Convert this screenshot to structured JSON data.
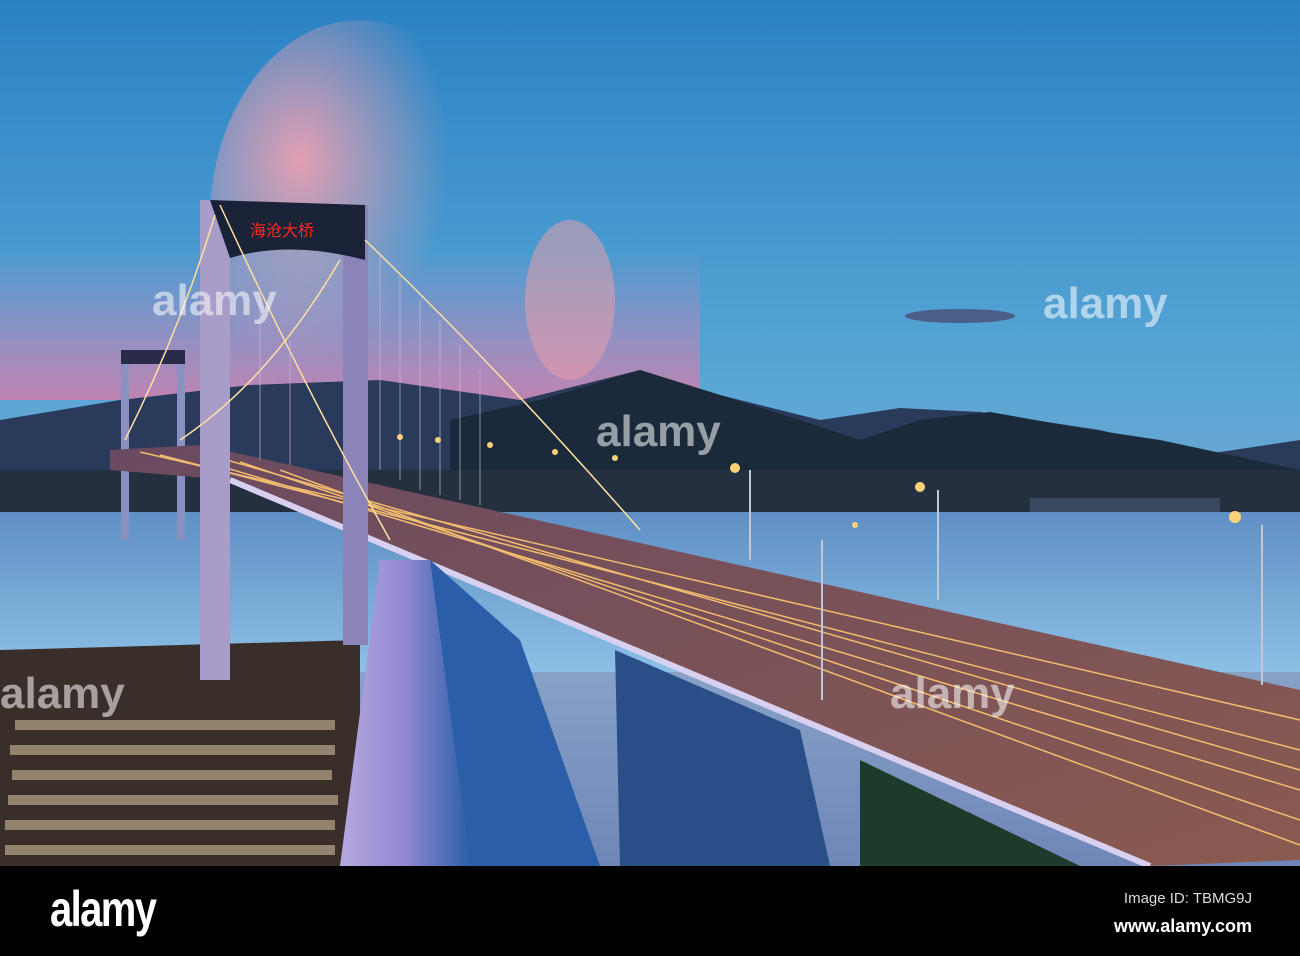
{
  "photo": {
    "subject": "suspension-bridge-at-dusk",
    "sign_text": "海沧大桥",
    "colors": {
      "sky_top": "#2a7fc0",
      "sky_pink": "#e88ab0",
      "water": "#7fb0d8",
      "light_trail": "#ffb347"
    }
  },
  "watermark": {
    "text": "alamy"
  },
  "footer": {
    "logo": "alamy",
    "image_id": "Image ID: TBMG9J",
    "website": "www.alamy.com"
  }
}
